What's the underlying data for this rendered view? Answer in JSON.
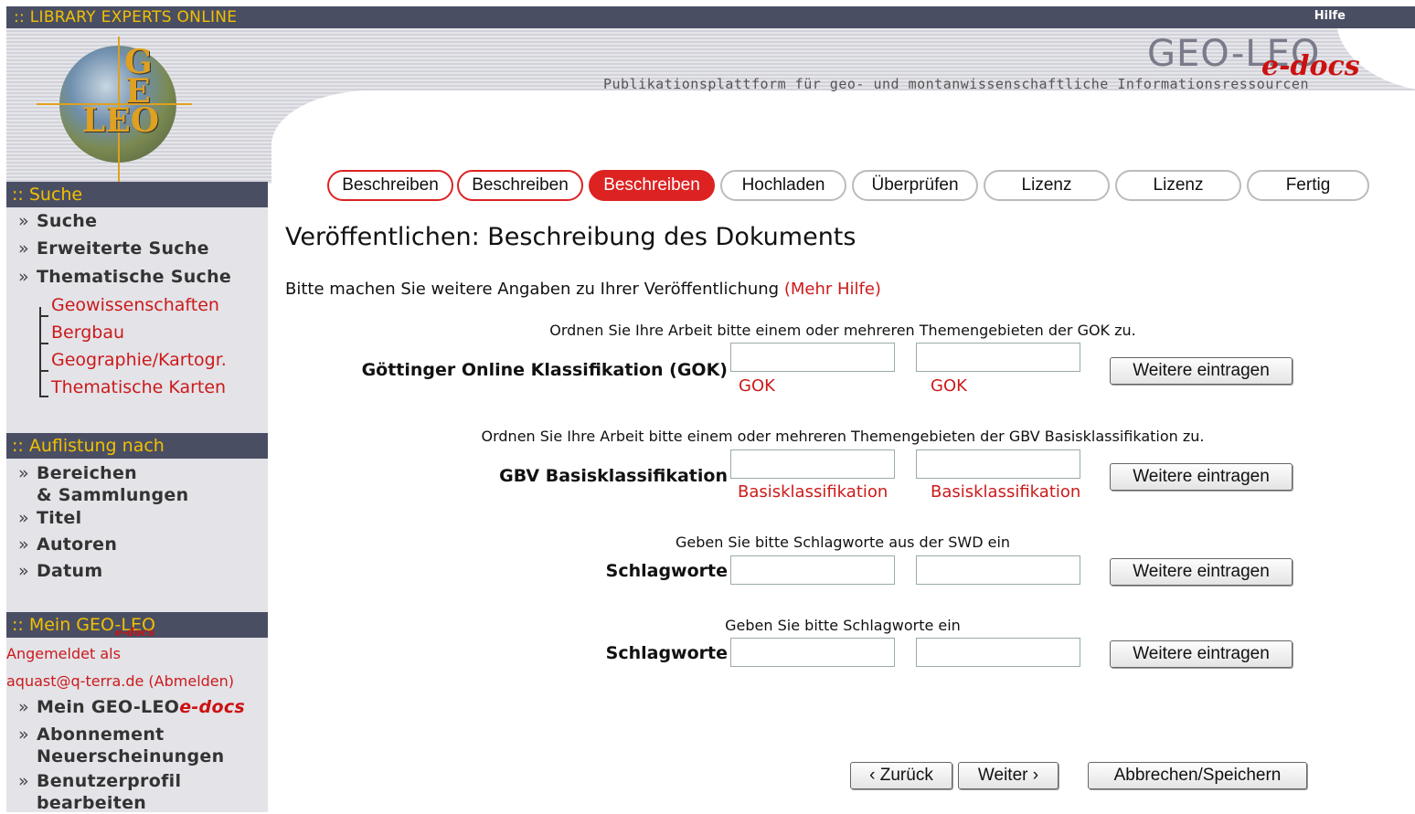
{
  "topbar": {
    "brand": ":: LIBRARY EXPERTS ONLINE",
    "help": "Hilfe"
  },
  "header": {
    "logo_letters": "G\nE\nLEO",
    "title": "GEO-LEO",
    "title_suffix": "e-docs",
    "subtitle": "Publikationsplattform für geo- und montanwissenschaftliche Informationsressourcen"
  },
  "sidebar": {
    "search_section": ":: Suche",
    "search_links": [
      "Suche",
      "Erweiterte Suche",
      "Thematische Suche"
    ],
    "thematic_links": [
      "Geowissenschaften",
      "Bergbau",
      "Geographie/Kartogr.",
      "Thematische Karten"
    ],
    "browse_section": ":: Auflistung nach",
    "browse_links": [
      "Bereichen\n& Sammlungen",
      "Titel",
      "Autoren",
      "Datum"
    ],
    "mine_section": ":: Mein GEO-LEO",
    "mine_section_suffix": "e-docs",
    "logged_in_as": "Angemeldet  als",
    "user_email": "aquast@q-terra.de (Abmelden)",
    "mine_link_prefix": "Mein GEO-LEO",
    "mine_link_suffix": "e-docs",
    "mine_links": [
      "Abonnement\nNeuerscheinungen",
      "Benutzerprofil\nbearbeiten"
    ]
  },
  "steps": [
    "Beschreiben",
    "Beschreiben",
    "Beschreiben",
    "Hochladen",
    "Überprüfen",
    "Lizenz",
    "Lizenz",
    "Fertig"
  ],
  "current_step_index": 2,
  "main": {
    "title": "Veröffentlichen: Beschreibung des Dokuments",
    "intro": "Bitte machen Sie weitere Angaben zu Ihrer Veröffentlichung",
    "more_help": "(Mehr Hilfe)"
  },
  "fields": [
    {
      "hint": "Ordnen Sie Ihre Arbeit bitte einem oder mehreren Themengebieten der GOK zu.",
      "label": "Göttinger Online Klassifikation (GOK)",
      "sublabels": [
        "GOK",
        "GOK"
      ],
      "values": [
        "",
        ""
      ],
      "button": "Weitere eintragen"
    },
    {
      "hint": "Ordnen Sie Ihre Arbeit bitte einem oder mehreren Themengebieten der GBV Basisklassifikation zu.",
      "label": "GBV Basisklassifikation",
      "sublabels": [
        "Basisklassifikation",
        "Basisklassifikation"
      ],
      "values": [
        "",
        ""
      ],
      "button": "Weitere eintragen"
    },
    {
      "hint": "Geben Sie bitte Schlagworte aus der SWD ein",
      "label": "Schlagworte",
      "sublabels": [
        "",
        ""
      ],
      "values": [
        "",
        ""
      ],
      "button": "Weitere eintragen"
    },
    {
      "hint": "Geben Sie bitte Schlagworte ein",
      "label": "Schlagworte",
      "sublabels": [
        "",
        ""
      ],
      "values": [
        "",
        ""
      ],
      "button": "Weitere eintragen"
    }
  ],
  "nav": {
    "back": "‹ Zurück",
    "next": "Weiter ›",
    "cancel": "Abbrechen/Speichern"
  },
  "colors": {
    "bar": "#4a4e63",
    "brand": "#f0c000",
    "accent": "#dd2222",
    "link": "#cc1a1a",
    "sidebar": "#e3e3e8"
  }
}
